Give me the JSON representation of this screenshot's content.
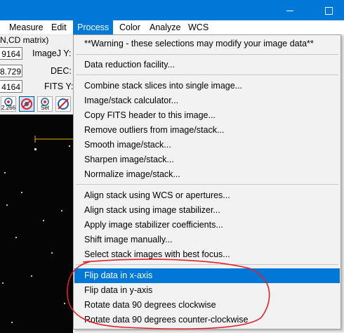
{
  "menubar": {
    "items": [
      "Measure",
      "Edit",
      "Process",
      "Color",
      "Analyze",
      "WCS"
    ],
    "active": "Process"
  },
  "left_panel": {
    "subheader": "N,CD matrix)",
    "coords": [
      {
        "value": "9164",
        "label": "ImageJ Y:"
      },
      {
        "value": "8.729",
        "label": "DEC:"
      },
      {
        "value": "4164",
        "label": "FITS Y:"
      }
    ],
    "toolbar": {
      "zoom_label": "2.266",
      "set_label": "Set"
    }
  },
  "process_menu": {
    "warning": "**Warning - these selections may modify your image data**",
    "groups": [
      [
        "Data reduction facility..."
      ],
      [
        "Combine stack slices into single image...",
        "Image/stack calculator...",
        "Copy FITS header to this image...",
        "Remove outliers from image/stack...",
        "Smooth image/stack...",
        "Sharpen image/stack...",
        "Normalize image/stack..."
      ],
      [
        "Align stack using WCS or apertures...",
        "Align stack using image stabilizer...",
        "Apply image stabilizer coefficients...",
        "Shift image manually...",
        "Select stack images with best focus..."
      ],
      [
        "Flip data in x-axis",
        "Flip data in y-axis",
        "Rotate data 90 degrees clockwise",
        "Rotate data 90 degrees counter-clockwise"
      ]
    ],
    "highlighted": "Flip data in x-axis"
  },
  "colors": {
    "titlebar": "#0078d7",
    "highlight": "#0078d7",
    "annotation": "#e0202a",
    "scale_bar": "#e8b400"
  }
}
